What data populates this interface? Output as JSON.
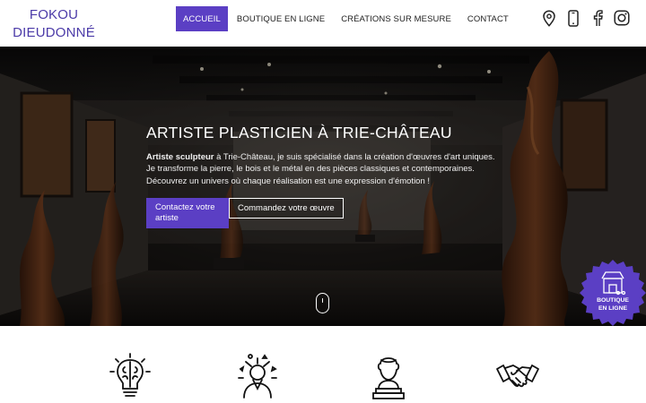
{
  "header": {
    "logo_line1": "FOKOU",
    "logo_line2": "DIEUDONNÉ",
    "nav": [
      {
        "label": "ACCUEIL",
        "active": true
      },
      {
        "label": "BOUTIQUE EN LIGNE",
        "active": false
      },
      {
        "label": "CRÉATIONS SUR MESURE",
        "active": false
      },
      {
        "label": "CONTACT",
        "active": false
      }
    ],
    "social_icons": [
      "map-pin-icon",
      "phone-icon",
      "facebook-icon",
      "instagram-icon"
    ]
  },
  "hero": {
    "title": "ARTISTE PLASTICIEN À TRIE-CHÂTEAU",
    "text_bold": "Artiste sculpteur",
    "text_rest": " à Trie-Château, je suis spécialisé dans la création d'œuvres d'art uniques. Je transforme la pierre, le bois et le métal en des pièces classiques et contemporaines. Découvrez un univers où chaque réalisation est une expression d'émotion !",
    "primary_button": "Contactez votre artiste",
    "secondary_button": "Commandez votre œuvre",
    "scroll_icon": "mouse-scroll-icon"
  },
  "shop_badge": {
    "line1": "BOUTIQUE",
    "line2": "EN LIGNE",
    "icon": "shop-icon"
  },
  "features": {
    "icons": [
      "brain-bulb-icon",
      "creative-mind-icon",
      "sculptor-bust-icon",
      "handshake-icon"
    ]
  },
  "colors": {
    "accent": "#5b3fc4",
    "logo": "#4b3aa8",
    "hero_bg": "#171412"
  }
}
